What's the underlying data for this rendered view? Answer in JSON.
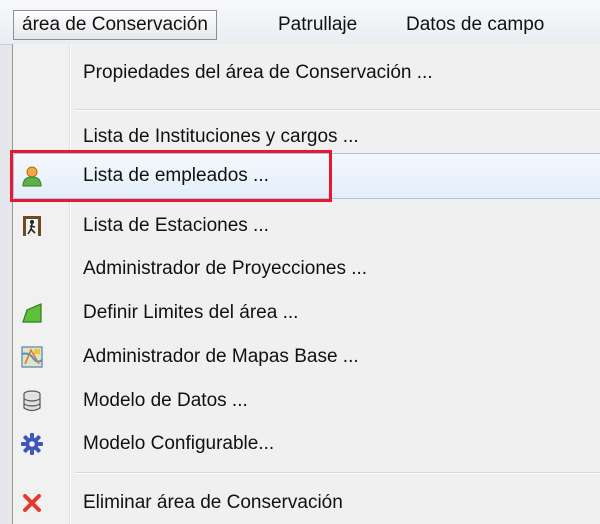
{
  "menubar": {
    "items": [
      {
        "label": "área de Conservación",
        "active": true
      },
      {
        "label": "Patrullaje",
        "active": false
      },
      {
        "label": "Datos de campo",
        "active": false
      }
    ]
  },
  "menu": {
    "items": [
      {
        "label": "Propiedades del área de Conservación ...",
        "icon": "none"
      },
      {
        "label": "Lista de Instituciones y cargos ...",
        "icon": "none"
      },
      {
        "label": "Lista de empleados ...",
        "icon": "person-icon"
      },
      {
        "label": "Lista de Estaciones ...",
        "icon": "door-exit-icon"
      },
      {
        "label": "Administrador de Proyecciones ...",
        "icon": "none"
      },
      {
        "label": "Definir Limites del área ...",
        "icon": "green-polygon-icon"
      },
      {
        "label": "Administrador de Mapas Base ...",
        "icon": "map-icon"
      },
      {
        "label": "Modelo de Datos ...",
        "icon": "database-icon"
      },
      {
        "label": "Modelo Configurable...",
        "icon": "gear-icon"
      },
      {
        "label": "Eliminar área de Conservación",
        "icon": "delete-x-icon"
      }
    ],
    "highlighted_index": 2,
    "accent_color": "#e8192c"
  }
}
